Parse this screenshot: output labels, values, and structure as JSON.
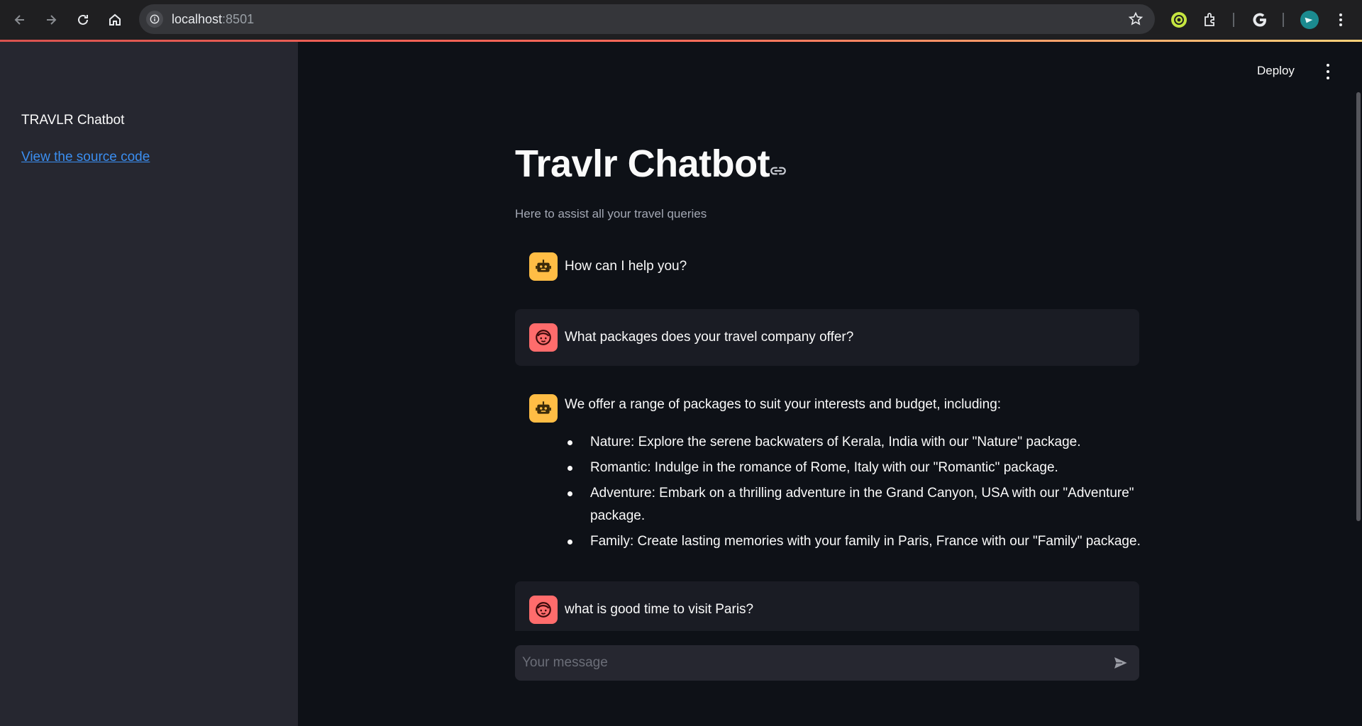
{
  "browser": {
    "url_host": "localhost",
    "url_port": ":8501"
  },
  "sidebar": {
    "title": "TRAVLR Chatbot",
    "link": "View the source code"
  },
  "header": {
    "deploy_label": "Deploy"
  },
  "main": {
    "title": "Travlr Chatbot",
    "subtitle": "Here to assist all your travel queries"
  },
  "messages": [
    {
      "role": "assistant",
      "text": "How can I help you?"
    },
    {
      "role": "user",
      "text": "What packages does your travel company offer?"
    },
    {
      "role": "assistant",
      "text": "We offer a range of packages to suit your interests and budget, including:",
      "bullets": [
        "Nature: Explore the serene backwaters of Kerala, India with our \"Nature\" package.",
        "Romantic: Indulge in the romance of Rome, Italy with our \"Romantic\" package.",
        "Adventure: Embark on a thrilling adventure in the Grand Canyon, USA with our \"Adventure\" package.",
        "Family: Create lasting memories with your family in Paris, France with our \"Family\" package."
      ]
    },
    {
      "role": "user",
      "text": "what is good time to visit Paris?"
    }
  ],
  "chat_input": {
    "placeholder": "Your message",
    "value": ""
  },
  "colors": {
    "background": "#0e1117",
    "sidebar": "#262730",
    "bot_avatar": "#ffbd45",
    "user_avatar": "#ff6c6c",
    "link": "#3b8ef0"
  }
}
